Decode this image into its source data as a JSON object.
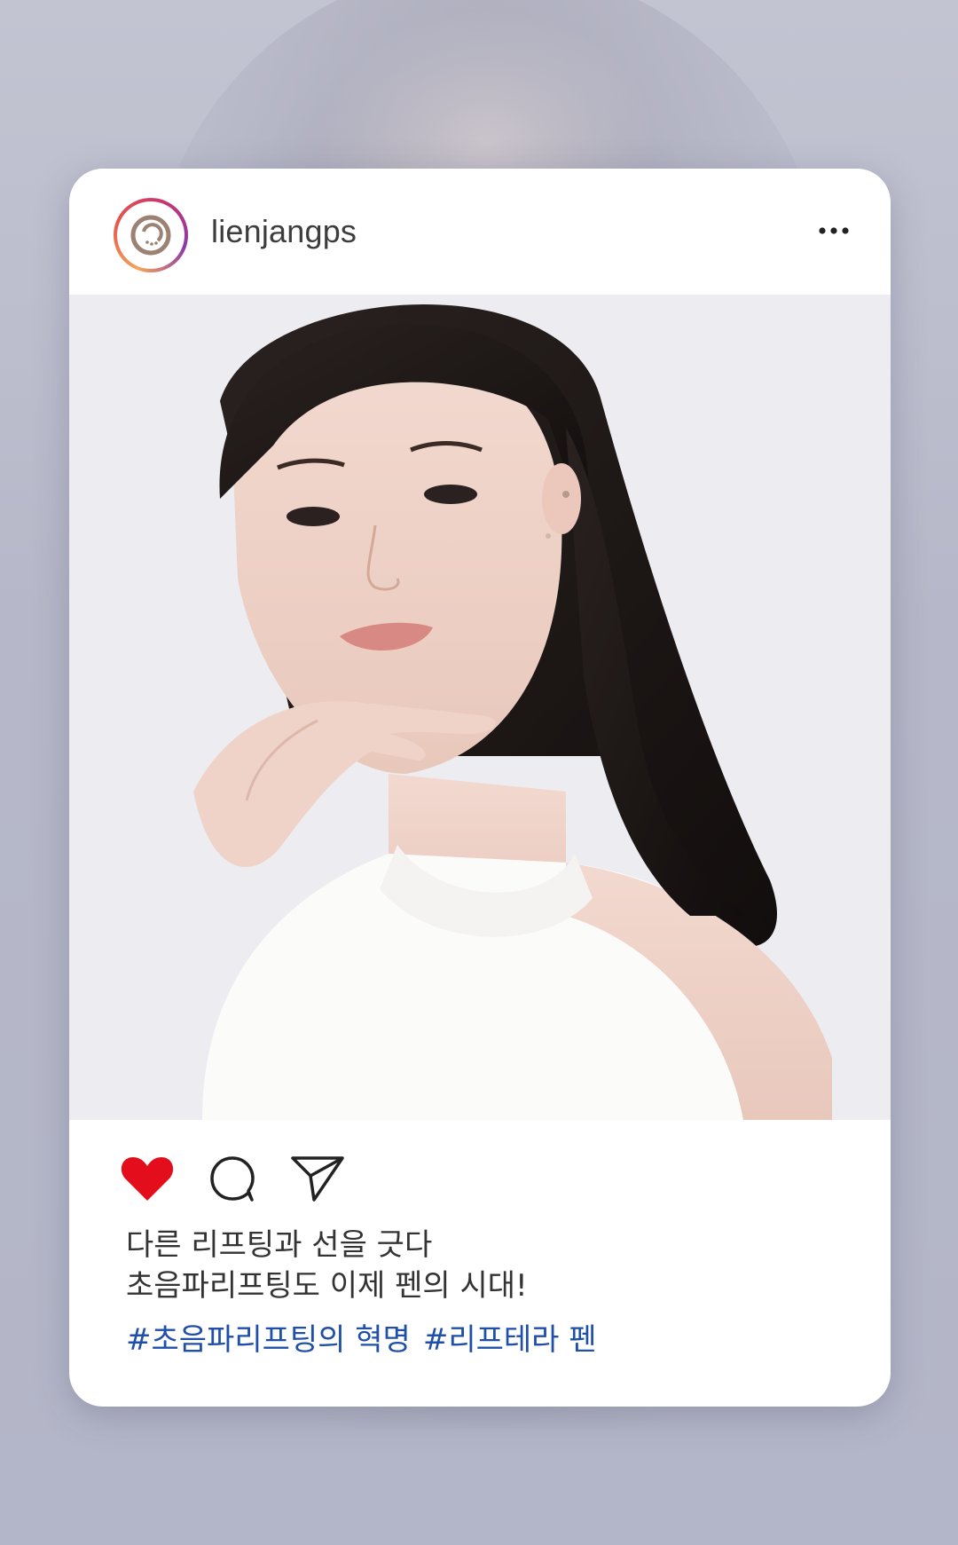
{
  "post": {
    "username": "lienjangps",
    "caption_line_1": "다른 리프팅과 선을 긋다",
    "caption_line_2": "초음파리프팅도 이제 펜의 시대!",
    "hashtags": [
      "#초음파리프팅의 혁명",
      "#리프테라 펜"
    ],
    "liked": true
  },
  "icons": {
    "avatar": "logo-icon",
    "more": "more-horizontal-icon",
    "like": "heart-icon",
    "comment": "comment-icon",
    "share": "send-icon"
  },
  "colors": {
    "heart": "#e40d1c",
    "hashtag": "#1f4fa8",
    "ring_start": "#f6a35b",
    "ring_end": "#8b3aa8"
  }
}
